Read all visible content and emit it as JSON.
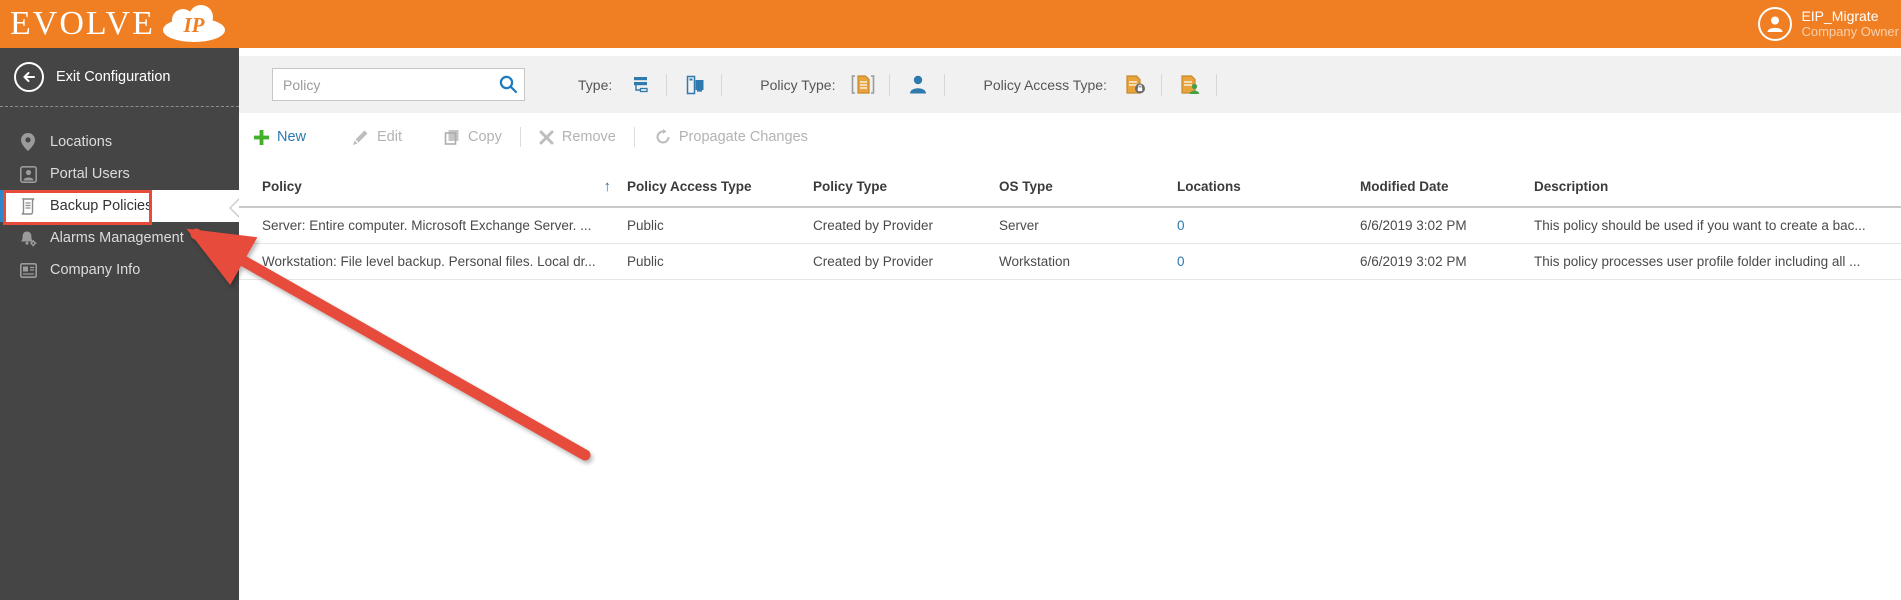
{
  "header": {
    "logo_brand": "EVOLVE",
    "logo_cloud_text": "IP",
    "user": {
      "name": "EIP_Migrate",
      "role": "Company Owner"
    }
  },
  "sidebar": {
    "exit_label": "Exit Configuration",
    "items": [
      {
        "label": "Locations",
        "icon": "location-pin-icon",
        "selected": false
      },
      {
        "label": "Portal Users",
        "icon": "portal-user-icon",
        "selected": false
      },
      {
        "label": "Backup Policies",
        "icon": "backup-scroll-icon",
        "selected": true
      },
      {
        "label": "Alarms Management",
        "icon": "alarm-bell-gear-icon",
        "selected": false
      },
      {
        "label": "Company Info",
        "icon": "company-card-icon",
        "selected": false
      }
    ]
  },
  "filters": {
    "search": {
      "placeholder": "Policy",
      "icon": "search-icon"
    },
    "type_label": "Type:",
    "policy_type_label": "Policy Type:",
    "policy_access_type_label": "Policy Access Type:"
  },
  "toolbar": {
    "new_label": "New",
    "edit_label": "Edit",
    "copy_label": "Copy",
    "remove_label": "Remove",
    "propagate_label": "Propagate Changes"
  },
  "table": {
    "columns": {
      "policy": "Policy",
      "access": "Policy Access Type",
      "type": "Policy Type",
      "os": "OS Type",
      "locations": "Locations",
      "modified": "Modified Date",
      "description": "Description"
    },
    "sort_indicator": "↑",
    "rows": [
      {
        "policy": "Server: Entire computer. Microsoft Exchange Server. ...",
        "access": "Public",
        "type": "Created by Provider",
        "os": "Server",
        "locations": "0",
        "modified": "6/6/2019 3:02 PM",
        "description": "This policy should be used if you want to create a bac..."
      },
      {
        "policy": "Workstation: File level backup. Personal files. Local dr...",
        "access": "Public",
        "type": "Created by Provider",
        "os": "Workstation",
        "locations": "0",
        "modified": "6/6/2019 3:02 PM",
        "description": "This policy processes user profile folder including all ..."
      }
    ]
  },
  "colors": {
    "brand_orange": "#f07f23",
    "sidebar_dark": "#454545",
    "accent_blue": "#2a7ab0",
    "selected_stripe_blue": "#2e86c8",
    "annotation_red": "#e64b3c",
    "doc_gold": "#e8a33d",
    "status_green": "#43a047"
  }
}
